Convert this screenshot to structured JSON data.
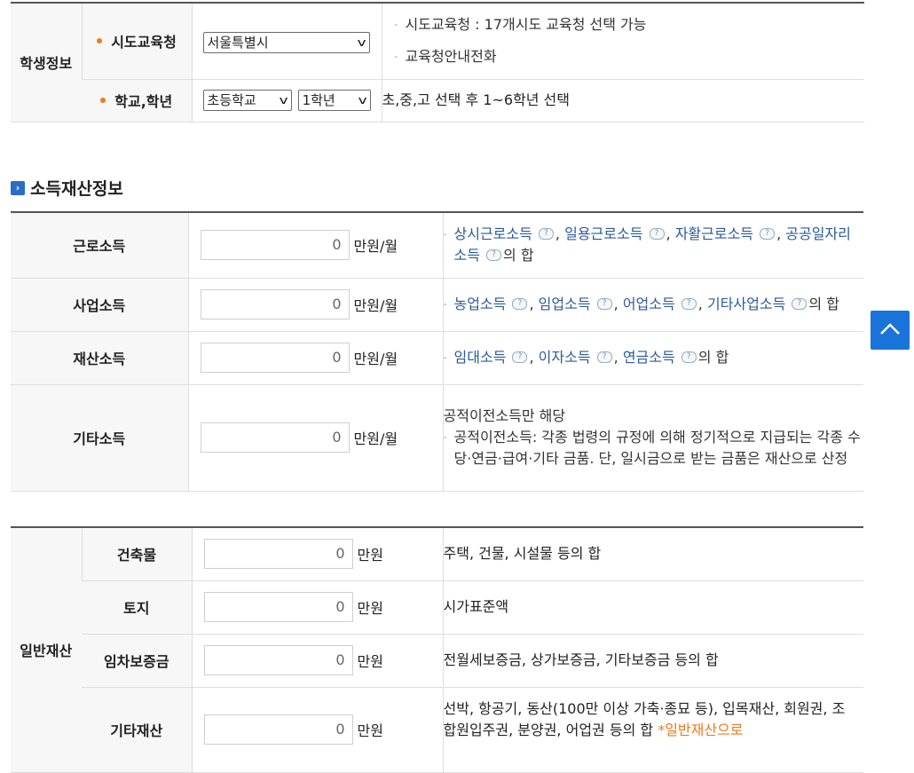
{
  "student": {
    "group": "학생정보",
    "office_label": "시도교육청",
    "office_value": "서울특별시",
    "office_note1": "시도교육청 : 17개시도 교육청 선택 가능",
    "office_note2": "교육청안내전화",
    "school_label": "학교,학년",
    "school_value": "초등학교",
    "grade_value": "1학년",
    "school_note": "초,중,고 선택 후 1~6학년 선택"
  },
  "income": {
    "section_title": "소득재산정보",
    "rows": [
      {
        "label": "근로소득",
        "value": "0",
        "unit": "만원/월",
        "items": [
          "상시근로소득",
          "일용근로소득",
          "자활근로소득",
          "공공일자리소득"
        ],
        "tail": "의 합"
      },
      {
        "label": "사업소득",
        "value": "0",
        "unit": "만원/월",
        "items": [
          "농업소득",
          "임업소득",
          "어업소득",
          "기타사업소득"
        ],
        "tail": "의 합"
      },
      {
        "label": "재산소득",
        "value": "0",
        "unit": "만원/월",
        "items": [
          "임대소득",
          "이자소득",
          "연금소득"
        ],
        "tail": "의 합"
      },
      {
        "label": "기타소득",
        "value": "0",
        "unit": "만원/월",
        "heading": "공적이전소득만 해당",
        "note": "공적이전소득: 각종 법령의 규정에 의해 정기적으로 지급되는 각종 수당·연금·급여·기타 금품. 단, 일시금으로 받는 금품은 재산으로 산정"
      }
    ]
  },
  "property": {
    "group": "일반재산",
    "rows": [
      {
        "label": "건축물",
        "value": "0",
        "unit": "만원",
        "desc": "주택, 건물, 시설물 등의 합"
      },
      {
        "label": "토지",
        "value": "0",
        "unit": "만원",
        "desc": "시가표준액"
      },
      {
        "label": "임차보증금",
        "value": "0",
        "unit": "만원",
        "desc": "전월세보증금, 상가보증금, 기타보증금 등의 합"
      },
      {
        "label": "기타재산",
        "value": "0",
        "unit": "만원",
        "desc": "선박, 항공기, 동산(100만 이상 가축·종묘 등), 입목재산, 회원권, 조합원입주권, 분양권, 어업권 등의 합",
        "desc_highlight": "*일반재산으로"
      }
    ]
  },
  "icons": {
    "help": "help-bubble-icon",
    "top": "arrow-up-icon",
    "section": "chevron-right-square-icon",
    "select": "chevron-down-icon"
  },
  "colors": {
    "accent": "#f07a1a",
    "link": "#2b5a9a",
    "top_button": "#1a73d9",
    "border_top": "#555555"
  }
}
